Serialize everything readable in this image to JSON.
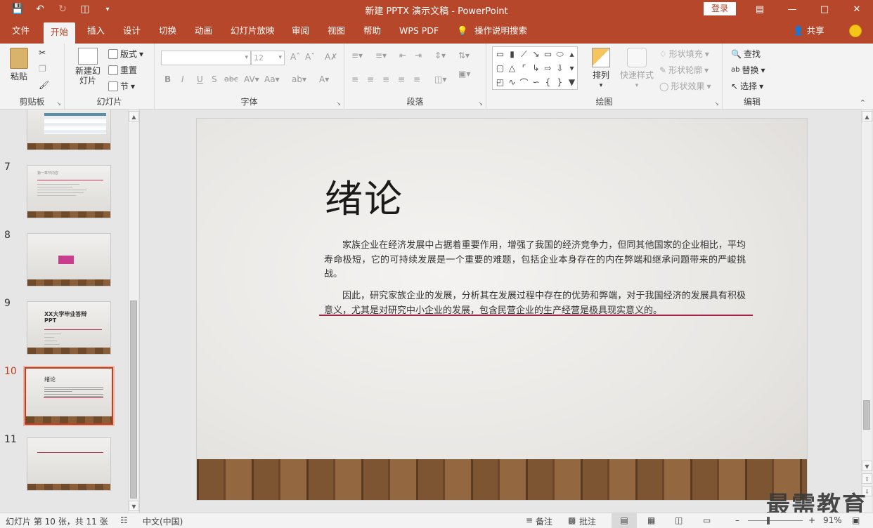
{
  "window": {
    "title": "新建 PPTX 演示文稿 - PowerPoint",
    "login": "登录"
  },
  "tabs": [
    "文件",
    "开始",
    "插入",
    "设计",
    "切换",
    "动画",
    "幻灯片放映",
    "审阅",
    "视图",
    "帮助",
    "WPS PDF",
    "操作说明搜索"
  ],
  "share": "共享",
  "ribbon": {
    "clipboard": {
      "label": "剪贴板",
      "paste": "粘贴"
    },
    "slides": {
      "label": "幻灯片",
      "new_slide": "新建幻灯片",
      "layout": "版式",
      "reset": "重置",
      "section": "节"
    },
    "font": {
      "label": "字体",
      "size": "12"
    },
    "paragraph": {
      "label": "段落"
    },
    "drawing": {
      "label": "绘图",
      "arrange": "排列",
      "quick_styles": "快速样式",
      "shape_fill": "形状填充",
      "shape_outline": "形状轮廓",
      "shape_effect": "形状效果"
    },
    "editing": {
      "label": "编辑",
      "find": "查找",
      "replace": "替换",
      "select": "选择"
    }
  },
  "thumbnails": [
    {
      "num": "7",
      "title": "第一章节内容"
    },
    {
      "num": "8",
      "title": ""
    },
    {
      "num": "9",
      "title": "XX大学毕业答辩PPT"
    },
    {
      "num": "10",
      "title": "绪论",
      "selected": true
    },
    {
      "num": "11",
      "title": ""
    }
  ],
  "slide": {
    "title": "绪论",
    "paragraph1": "家族企业在经济发展中占据着重要作用，增强了我国的经济竞争力，但同其他国家的企业相比，平均寿命极短，它的可持续发展是一个重要的难题，包括企业本身存在的内在弊端和继承问题带来的严峻挑战。",
    "paragraph2": "因此，研究家族企业的发展，分析其在发展过程中存在的优势和弊端，对于我国经济的发展具有积极意义，尤其是对研究中小企业的发展，包含民营企业的生产经营是极具现实意义的。"
  },
  "status": {
    "slide_info": "幻灯片 第 10 张，共 11 张",
    "language": "中文(中国)",
    "notes": "备注",
    "comments": "批注",
    "zoom": "91%"
  },
  "watermark": "最需教育",
  "colors": {
    "accent": "#b7472a",
    "selected": "#c43e1c",
    "underline": "#a8234a"
  }
}
